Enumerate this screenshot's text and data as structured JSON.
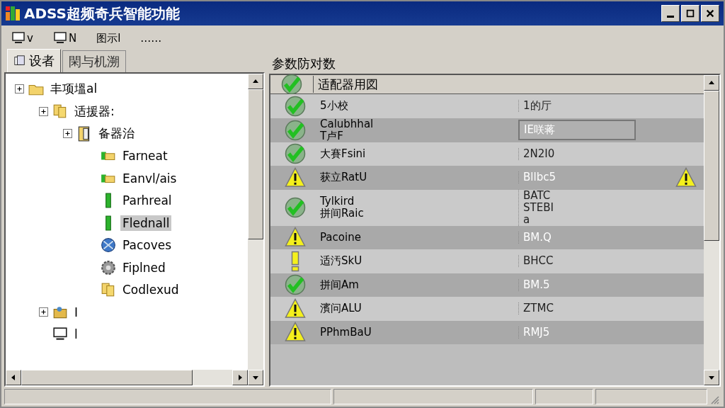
{
  "window": {
    "title": "ADSS超频奇兵智能功能"
  },
  "menu": [
    {
      "kind": "monitor",
      "label": "v"
    },
    {
      "kind": "monitor",
      "label": "N"
    },
    {
      "kind": "text",
      "label": "图示l"
    },
    {
      "kind": "text",
      "label": "……"
    }
  ],
  "tabs": [
    {
      "label": "设者",
      "kind": "page",
      "selected": true
    },
    {
      "label": "閑与机溯",
      "kind": "text",
      "selected": false
    }
  ],
  "tree": [
    {
      "label": "丰项塭al",
      "kind": "folder",
      "expander": true,
      "children": [
        {
          "label": "适援器:",
          "kind": "folders",
          "expander": true,
          "children": [
            {
              "label": "备器治",
              "kind": "binder",
              "expander": true,
              "children": [
                {
                  "label": "Farneat",
                  "kind": "tabfolder",
                  "expander": false,
                  "selected": false
                },
                {
                  "label": "Eanvl/ais",
                  "kind": "tabfolder",
                  "expander": false,
                  "selected": false
                },
                {
                  "label": "Parhreal",
                  "kind": "bar",
                  "expander": false,
                  "selected": false
                },
                {
                  "label": "Flednall",
                  "kind": "bar",
                  "expander": false,
                  "selected": true
                },
                {
                  "label": "Pacoves",
                  "kind": "globe",
                  "expander": false,
                  "selected": false
                },
                {
                  "label": "Fiplned",
                  "kind": "gear",
                  "expander": false,
                  "selected": false
                },
                {
                  "label": "Codlexud",
                  "kind": "folders",
                  "expander": false,
                  "selected": false
                }
              ]
            }
          ]
        },
        {
          "label": "I",
          "kind": "people",
          "expander": true
        },
        {
          "label": "l",
          "kind": "monitor",
          "expander": false
        }
      ]
    }
  ],
  "panel": {
    "title": "参数防对数",
    "header": "适配器用図"
  },
  "rows": [
    {
      "kind": "check",
      "name": [
        "5小校"
      ],
      "value": [
        "1的厅"
      ]
    },
    {
      "kind": "check",
      "name": [
        "Calubhhal",
        "T卢F"
      ],
      "value": [
        "IE咲蒋"
      ],
      "boxed": true
    },
    {
      "kind": "check",
      "name": [
        "大賽Fsini"
      ],
      "value": [
        "2N2I0"
      ]
    },
    {
      "kind": "warning",
      "name": [
        "获立RatU"
      ],
      "value": [
        "Bllbc5"
      ],
      "alert": true
    },
    {
      "kind": "check",
      "name": [
        "Tylkird",
        "拼间Raic"
      ],
      "value": [
        "BATC",
        "STEBI",
        "a"
      ]
    },
    {
      "kind": "warning",
      "name": [
        "Pacoine"
      ],
      "value": [
        "BM.Q"
      ]
    },
    {
      "kind": "exclaim",
      "name": [
        "适汚SkU"
      ],
      "value": [
        "BHCC"
      ]
    },
    {
      "kind": "check",
      "name": [
        "拼间Am"
      ],
      "value": [
        "BM.5"
      ]
    },
    {
      "kind": "warning",
      "name": [
        "濱问ALU"
      ],
      "value": [
        "ZTMC"
      ]
    },
    {
      "kind": "warning",
      "name": [
        "PPhmBaU"
      ],
      "value": [
        "RMJ5"
      ]
    }
  ]
}
